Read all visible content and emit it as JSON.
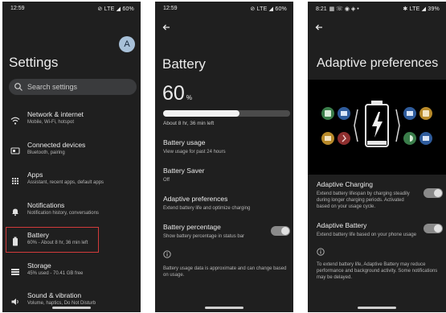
{
  "panel1": {
    "status": {
      "time": "12:59",
      "network": "LTE",
      "battery": "60%"
    },
    "avatar": "A",
    "title": "Settings",
    "search_placeholder": "Search settings",
    "items": [
      {
        "title": "Network & internet",
        "subtitle": "Mobile, Wi-Fi, hotspot",
        "icon": "wifi-icon"
      },
      {
        "title": "Connected devices",
        "subtitle": "Bluetooth, pairing",
        "icon": "devices-icon"
      },
      {
        "title": "Apps",
        "subtitle": "Assistant, recent apps, default apps",
        "icon": "apps-grid-icon"
      },
      {
        "title": "Notifications",
        "subtitle": "Notification history, conversations",
        "icon": "bell-icon"
      },
      {
        "title": "Battery",
        "subtitle": "60% - About 8 hr, 36 min left",
        "icon": "battery-icon"
      },
      {
        "title": "Storage",
        "subtitle": "45% used - 70.41 GB free",
        "icon": "storage-icon"
      },
      {
        "title": "Sound & vibration",
        "subtitle": "Volume, haptics, Do Not Disturb",
        "icon": "speaker-icon"
      }
    ],
    "highlight_color": "#d23b3b"
  },
  "panel2": {
    "status": {
      "time": "12:59",
      "network": "LTE",
      "battery": "60%"
    },
    "title": "Battery",
    "percent": "60",
    "percent_unit": "%",
    "level": 0.6,
    "remaining": "About 8 hr, 36 min left",
    "rows": [
      {
        "title": "Battery usage",
        "subtitle": "View usage for past 24 hours"
      },
      {
        "title": "Battery Saver",
        "subtitle": "Off"
      },
      {
        "title": "Adaptive preferences",
        "subtitle": "Extend battery life and optimize charging"
      },
      {
        "title": "Battery percentage",
        "subtitle": "Show battery percentage in status bar",
        "toggle": true
      }
    ],
    "note": "Battery usage data is approximate and can change based on usage."
  },
  "panel3": {
    "status": {
      "time": "8:21",
      "network": "LTE",
      "battery": "39%"
    },
    "title": "Adaptive preferences",
    "rows": [
      {
        "title": "Adaptive Charging",
        "subtitle": "Extend battery lifespan by charging steadily during longer charging periods. Activated based on your usage cycle.",
        "toggle": true
      },
      {
        "title": "Adaptive Battery",
        "subtitle": "Extend battery life based on your phone usage",
        "toggle": true
      }
    ],
    "note": "To extend battery life, Adaptive Battery may reduce performance and background activity. Some notifications may be delayed."
  }
}
